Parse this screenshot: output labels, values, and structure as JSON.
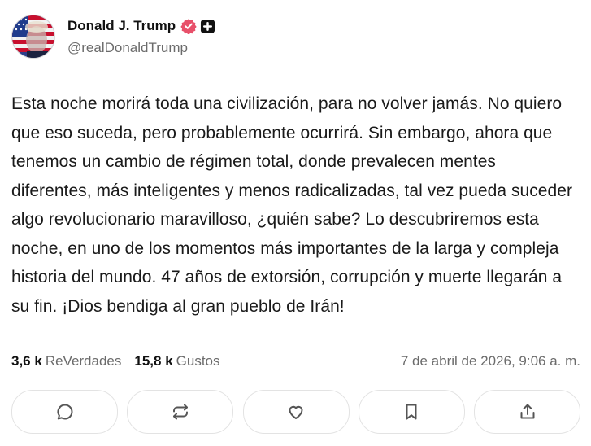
{
  "post": {
    "author": {
      "display_name": "Donald J. Trump",
      "handle": "@realDonaldTrump",
      "verified_color": "#e8506a",
      "avatar_icon": "flag-portrait-avatar",
      "badge_icon": "plus-badge-icon"
    },
    "text": "Esta noche morirá toda una civilización, para no volver jamás. No quiero que eso suceda, pero probablemente ocurrirá. Sin embargo, ahora que tenemos un cambio de régimen total, donde prevalecen mentes diferentes, más inteligentes y menos radicalizadas, tal vez pueda suceder algo revolucionario maravilloso, ¿quién sabe? Lo descubriremos esta noche, en uno de los momentos más importantes de la larga y compleja historia del mundo. 47 años de extorsión, corrupción y muerte llegarán a su fin. ¡Dios bendiga al gran pueblo de Irán!",
    "stats": {
      "reposts_count": "3,6 k",
      "reposts_label": "ReVerdades",
      "likes_count": "15,8 k",
      "likes_label": "Gustos"
    },
    "timestamp": "7 de abril de 2026, 9:06 a. m."
  },
  "actions": [
    {
      "icon": "reply-icon"
    },
    {
      "icon": "repost-icon"
    },
    {
      "icon": "heart-icon"
    },
    {
      "icon": "bookmark-icon"
    },
    {
      "icon": "share-icon"
    }
  ]
}
